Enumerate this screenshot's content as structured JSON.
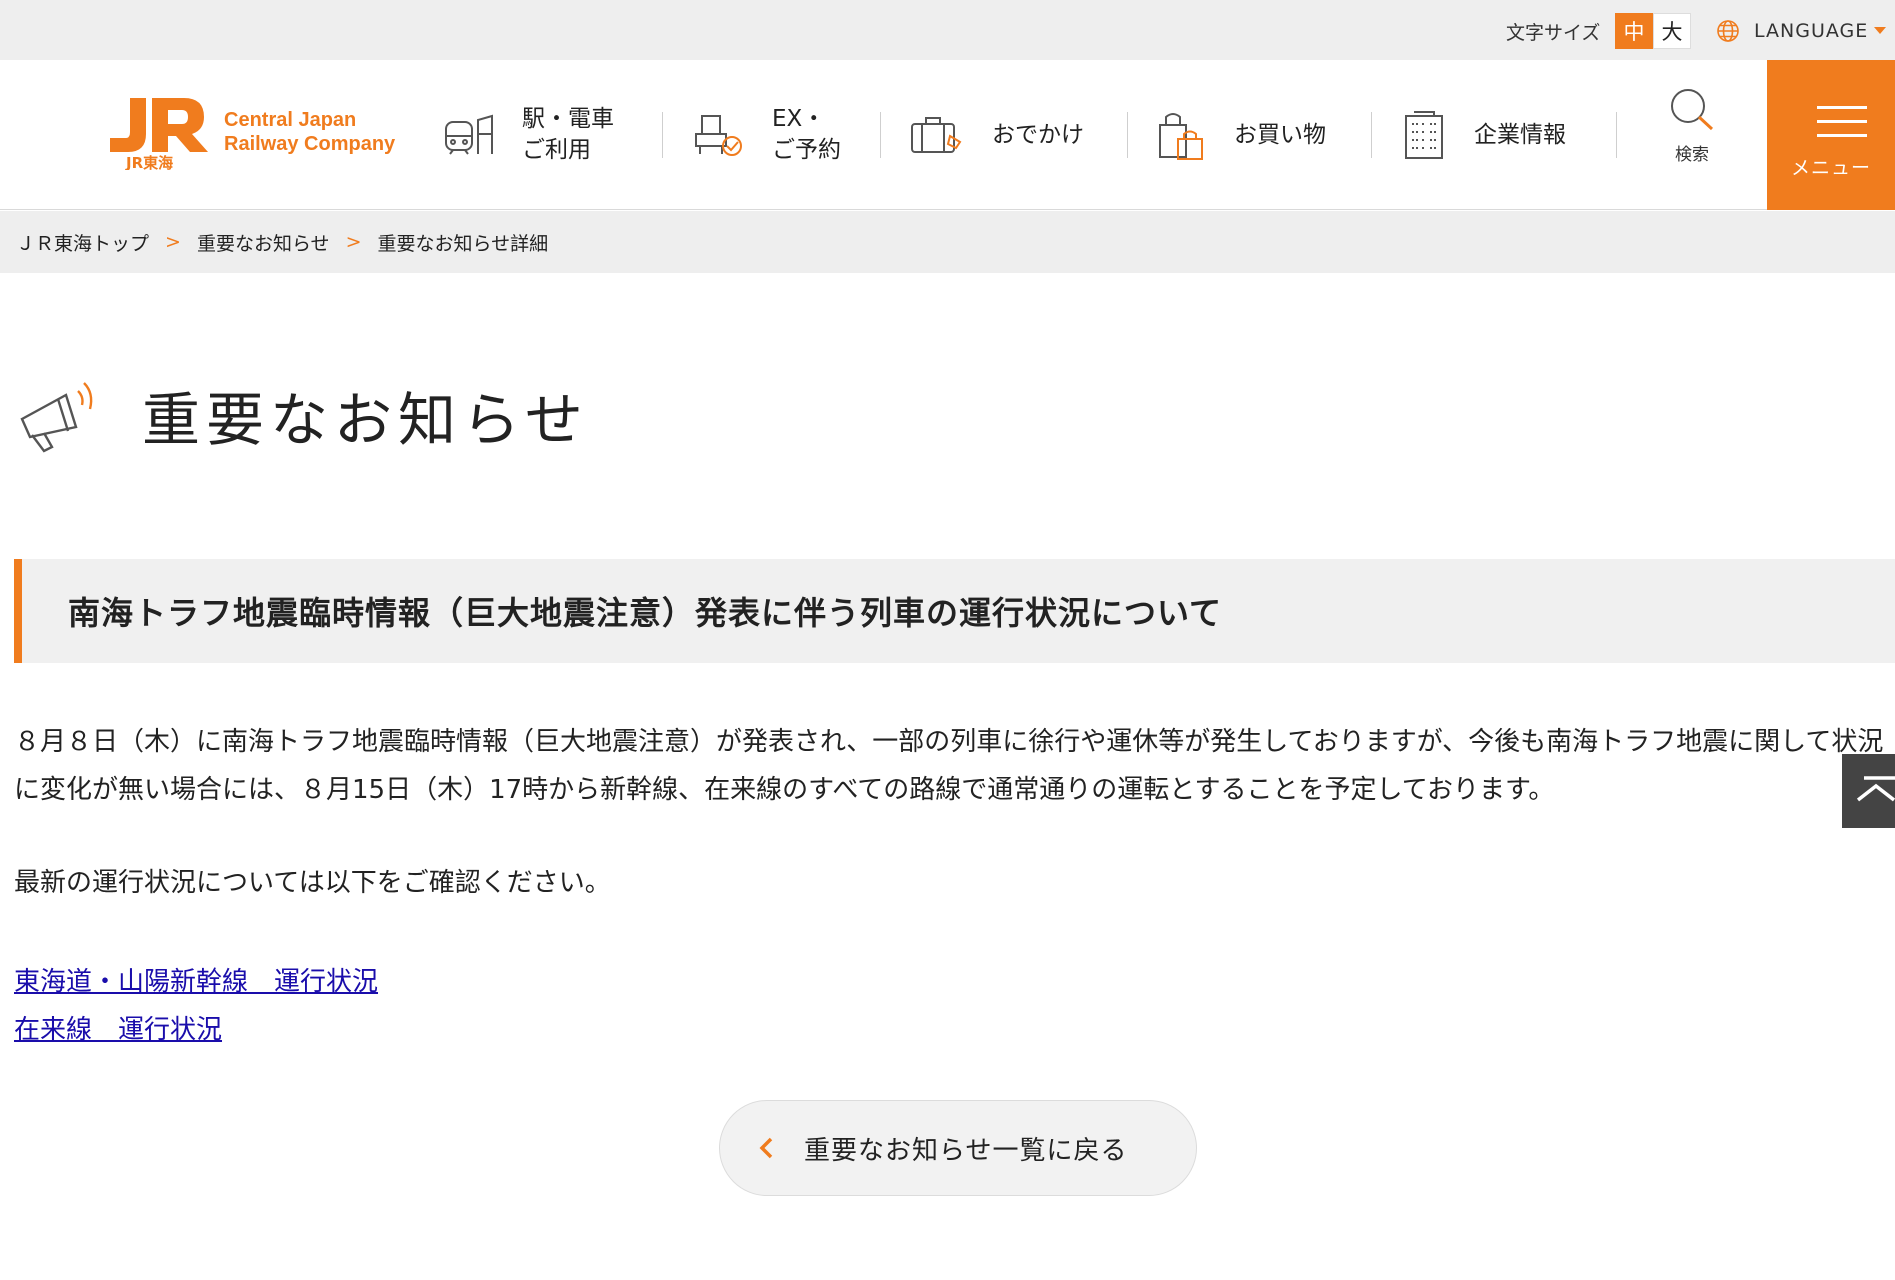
{
  "utility": {
    "font_size_label": "文字サイズ",
    "size_medium": "中",
    "size_large": "大",
    "language_label": "LANGUAGE"
  },
  "logo": {
    "brand_line1": "Central Japan",
    "brand_line2": "Railway Company",
    "jr_text": "JR東海"
  },
  "nav": {
    "items": [
      {
        "label_line1": "駅・電車",
        "label_line2": "ご利用",
        "icon": "train-icon"
      },
      {
        "label_line1": "EX・",
        "label_line2": "ご予約",
        "icon": "seat-check-icon"
      },
      {
        "label_line1": "おでかけ",
        "label_line2": "",
        "icon": "suitcase-icon"
      },
      {
        "label_line1": "お買い物",
        "label_line2": "",
        "icon": "shopping-bag-icon"
      },
      {
        "label_line1": "企業情報",
        "label_line2": "",
        "icon": "building-icon"
      }
    ],
    "search_label": "検索",
    "menu_label": "メニュー"
  },
  "colors": {
    "accent": "#f07c1e",
    "link": "#1a0dab"
  },
  "breadcrumb": {
    "items": [
      "ＪＲ東海トップ",
      "重要なお知らせ",
      "重要なお知らせ詳細"
    ]
  },
  "page": {
    "title": "重要なお知らせ",
    "notice_title": "南海トラフ地震臨時情報（巨大地震注意）発表に伴う列車の運行状況について",
    "paragraph1": "８月８日（木）に南海トラフ地震臨時情報（巨大地震注意）が発表され、一部の列車に徐行や運休等が発生しておりますが、今後も南海トラフ地震に関して状況に変化が無い場合には、８月15日（木）17時から新幹線、在来線のすべての路線で通常通りの運転とすることを予定しております。",
    "paragraph2": "最新の運行状況については以下をご確認ください。",
    "links": [
      "東海道・山陽新幹線　運行状況",
      "在来線　運行状況"
    ],
    "back_button": "重要なお知らせ一覧に戻る"
  }
}
